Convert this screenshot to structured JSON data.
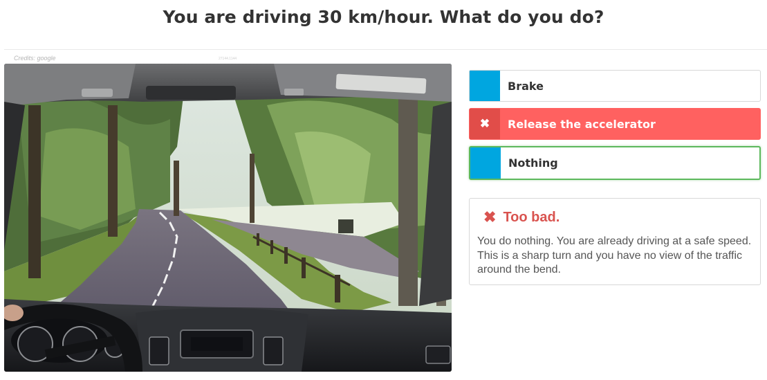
{
  "question": "You are driving 30 km/hour. What do you do?",
  "image": {
    "credits": "Credits: google",
    "tiny_id": "27144.1144"
  },
  "options": [
    {
      "label": "Brake",
      "state": "default"
    },
    {
      "label": "Release the accelerator",
      "state": "wrong-selected",
      "icon": "close-icon"
    },
    {
      "label": "Nothing",
      "state": "correct"
    }
  ],
  "feedback": {
    "icon": "close-icon",
    "title": "Too bad.",
    "text": "You do nothing. You are already driving at a safe speed. This is a sharp turn and you have no view of the traffic around the bend."
  },
  "colors": {
    "marker_blue": "#00a6e0",
    "wrong_red": "#ff6160",
    "correct_green": "#5cb85c",
    "feedback_red": "#d9534f"
  }
}
